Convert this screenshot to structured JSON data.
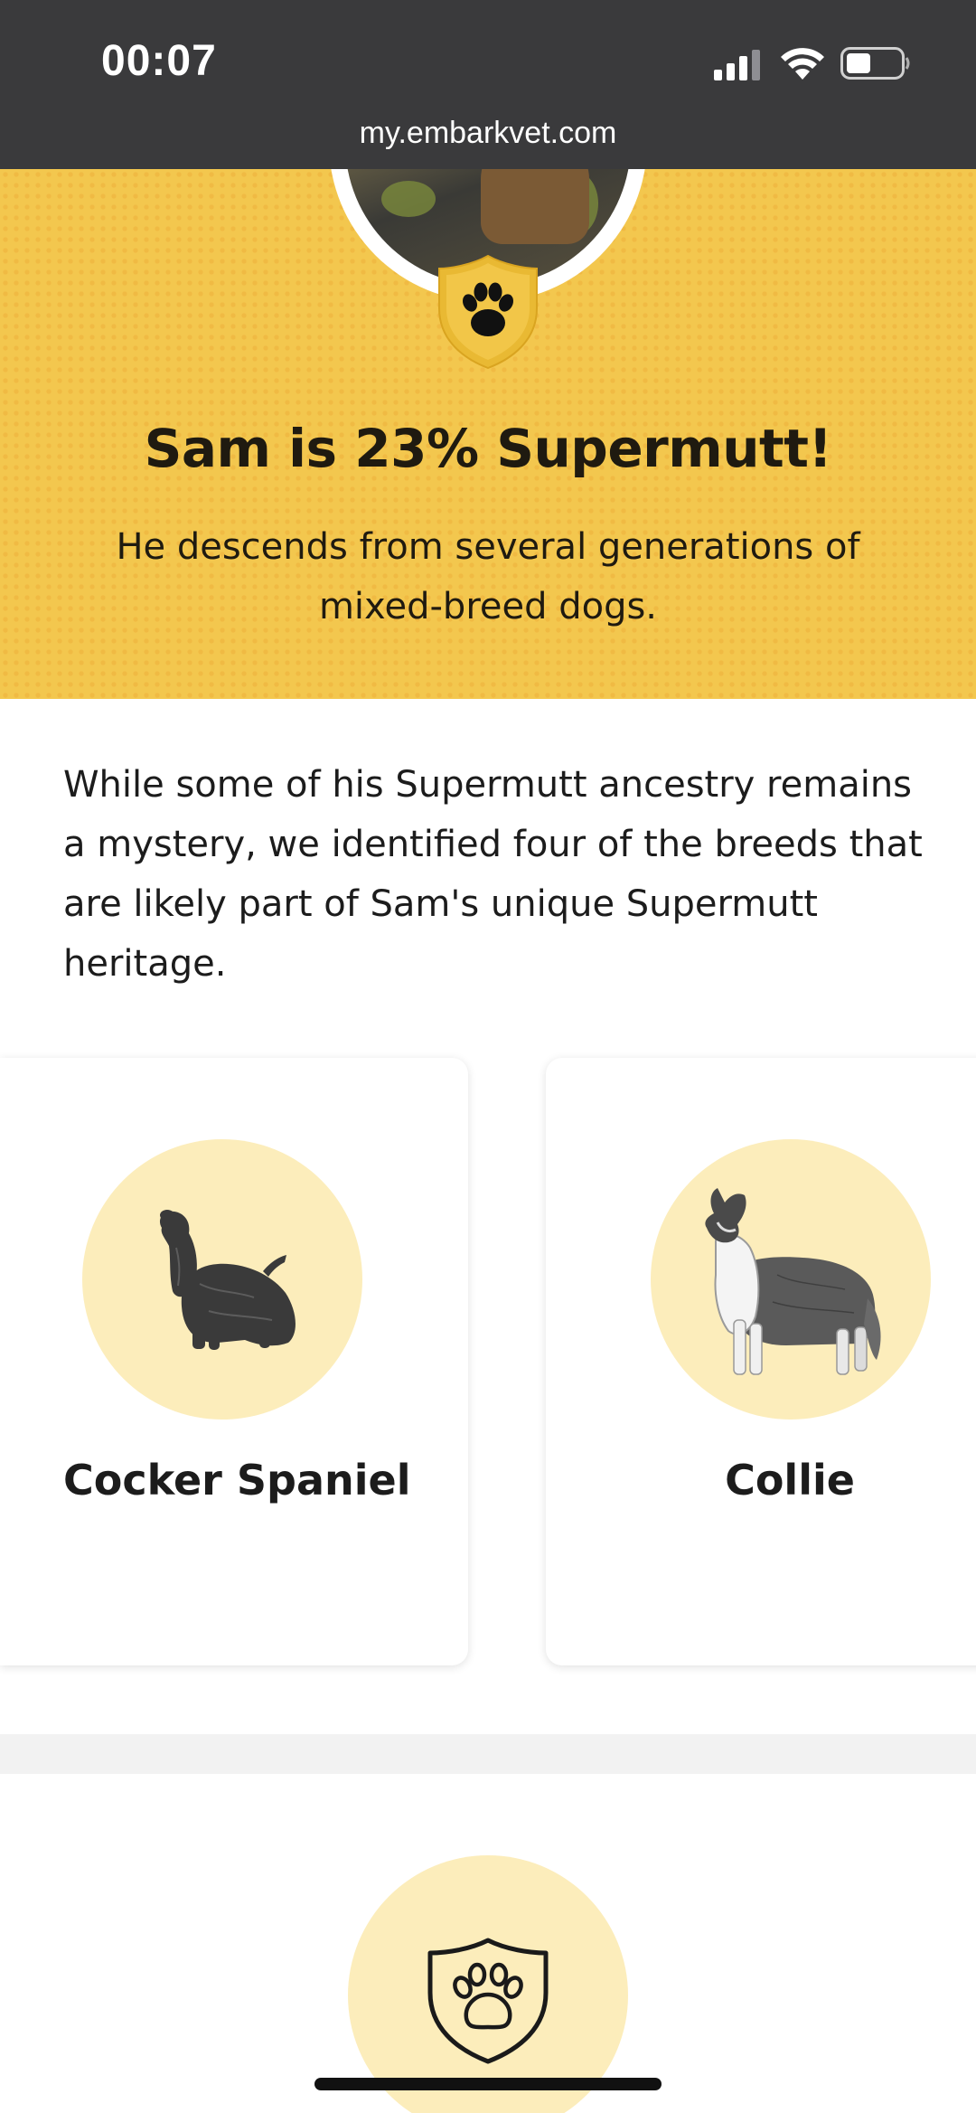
{
  "status_bar": {
    "time": "00:07",
    "url": "my.embarkvet.com",
    "icons": [
      "signal-icon",
      "wifi-icon",
      "battery-icon"
    ]
  },
  "hero": {
    "title": "Sam is 23% Supermutt!",
    "subtitle": "He descends from several generations of mixed-breed dogs.",
    "badge_icon": "paw-icon",
    "background_color": "#f3c74e"
  },
  "intro": {
    "text": "While some of his Supermutt ancestry remains a mystery, we identified four of the breeds that are likely part of Sam's unique Supermutt heritage."
  },
  "breeds": [
    {
      "name": "Cocker Spaniel",
      "icon": "cocker-spaniel-illustration"
    },
    {
      "name": "Collie",
      "icon": "collie-illustration"
    }
  ],
  "bottom_section": {
    "icon": "shield-paw-icon"
  },
  "colors": {
    "accent_yellow": "#f3c74e",
    "circle_fill": "#fcedbb",
    "status_bar": "#3a3a3c",
    "text_dark": "#1c1c1c"
  }
}
